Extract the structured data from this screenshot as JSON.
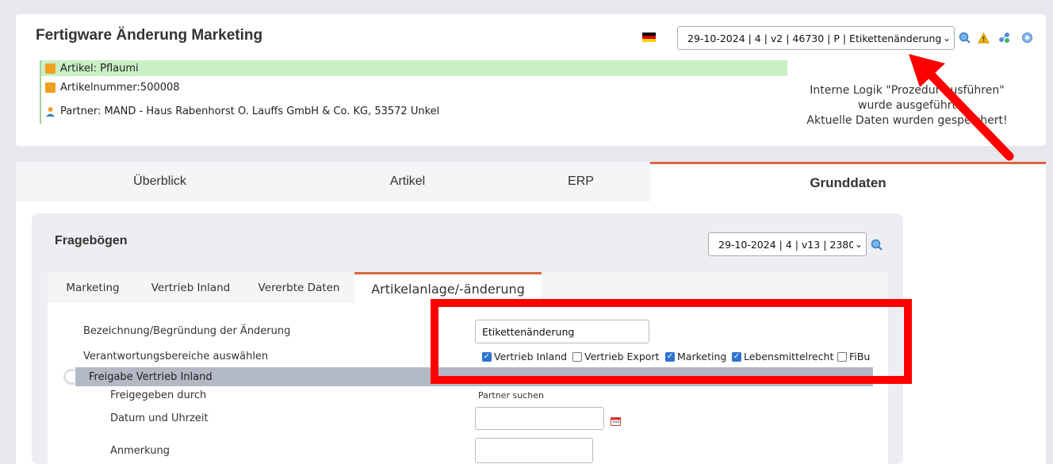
{
  "header": {
    "title": "Fertigware Änderung Marketing",
    "version_select": "29-10-2024 | 4 | v2 | 46730 | P | Etikettenänderung",
    "flag_icon": "german-flag-icon",
    "icons": [
      "search-icon",
      "warning-icon",
      "share-icon",
      "globe-icon"
    ]
  },
  "info": {
    "artikel": "Artikel: Pflaumi",
    "artikelnummer": "Artikelnummer:500008",
    "partner": "Partner: MAND - Haus Rabenhorst O. Lauffs GmbH & Co. KG, 53572 Unkel"
  },
  "message": {
    "line1": "Interne Logik \"Prozedur ausführen\"",
    "line2": "wurde ausgeführt",
    "line3": "Aktuelle Daten wurden gespeichert!"
  },
  "main_tabs": [
    "Überblick",
    "Artikel",
    "ERP",
    "Grunddaten"
  ],
  "fragebogen": {
    "title": "Fragebögen",
    "version_select": "29-10-2024 | 4 | v13 | 2380"
  },
  "sub_tabs": [
    "Marketing",
    "Vertrieb Inland",
    "Vererbte Daten",
    "Artikelanlage/-änderung"
  ],
  "form": {
    "bezeichnung_label": "Bezeichnung/Begründung der Änderung",
    "bezeichnung_value": "Etikettenänderung",
    "verantwortung_label": "Verantwortungsbereiche auswählen",
    "checkboxes": [
      {
        "label": "Vertrieb Inland",
        "checked": true
      },
      {
        "label": "Vertrieb Export",
        "checked": false
      },
      {
        "label": "Marketing",
        "checked": true
      },
      {
        "label": "Lebensmittelrecht",
        "checked": true
      },
      {
        "label": "FiBu",
        "checked": false
      }
    ],
    "freigabe_header": "Freigabe Vertrieb Inland",
    "freigegeben_label": "Freigegeben durch",
    "partner_suchen": "Partner suchen",
    "datum_label": "Datum und Uhrzeit",
    "anmerkung_label": "Anmerkung"
  },
  "colors": {
    "accent": "#d9663f",
    "highlight": "#ff0000",
    "green": "#c9efc4"
  }
}
